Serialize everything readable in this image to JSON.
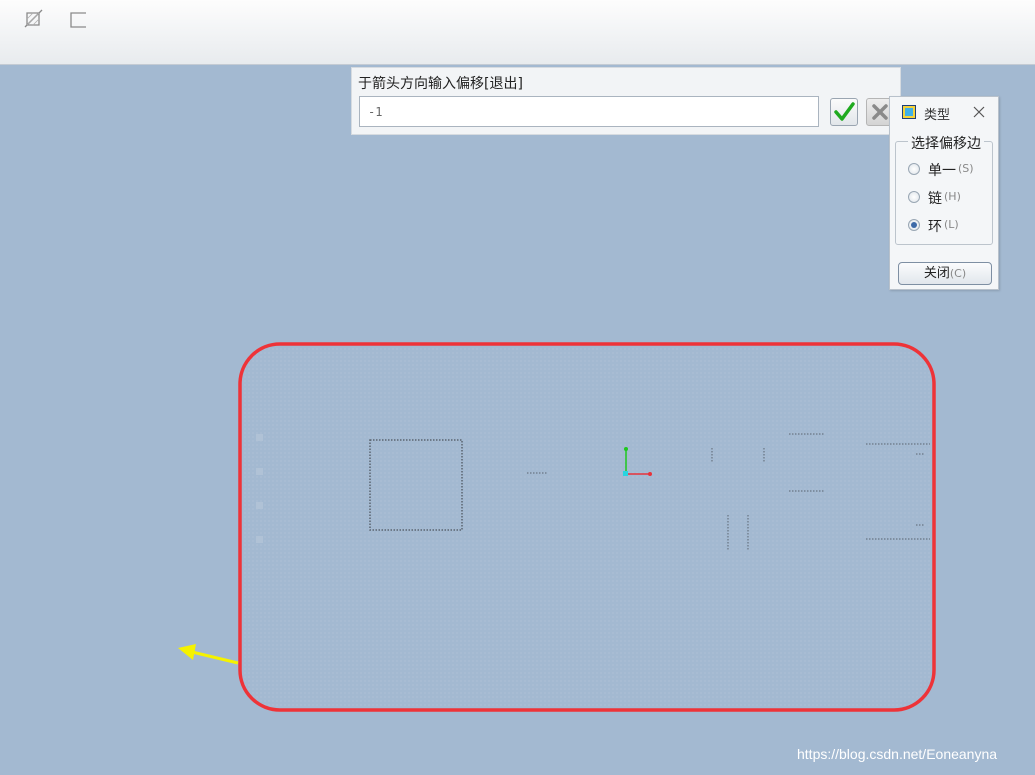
{
  "prompt": {
    "message": "于箭头方向输入偏移[退出]",
    "value": "-1"
  },
  "toolbar": {
    "icons": [
      "sketch-plane-icon",
      "reference-icon"
    ]
  },
  "type_panel": {
    "title": "类型",
    "group_title": "选择偏移边",
    "options": [
      {
        "label": "单一",
        "key": "(S)",
        "selected": false
      },
      {
        "label": "链",
        "key": "(H)",
        "selected": false
      },
      {
        "label": "环",
        "key": "(L)",
        "selected": true
      }
    ],
    "close_label": "关闭",
    "close_key": "(C)"
  },
  "colors": {
    "viewport": "#a3b9d1",
    "loop": "#ee3338",
    "arrow": "#f5f200",
    "axis_x": "#e8323a",
    "axis_y": "#1ec81e",
    "ok_check": "#1faa1f"
  },
  "watermark": "https://blog.csdn.net/Eoneanyna"
}
